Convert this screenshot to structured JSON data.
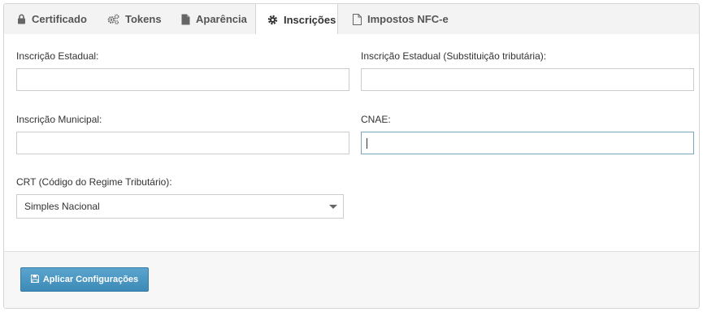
{
  "tabs": [
    {
      "label": "Certificado",
      "icon": "lock-icon"
    },
    {
      "label": "Tokens",
      "icon": "gears-icon"
    },
    {
      "label": "Aparência",
      "icon": "file-icon"
    },
    {
      "label": "Inscrições",
      "icon": "gear-icon",
      "active": true
    },
    {
      "label": "Impostos NFC-e",
      "icon": "file-outline-icon"
    }
  ],
  "form": {
    "inscricao_estadual": {
      "label": "Inscrição Estadual:",
      "value": ""
    },
    "inscricao_estadual_st": {
      "label": "Inscrição Estadual (Substituição tributária):",
      "value": ""
    },
    "inscricao_municipal": {
      "label": "Inscrição Municipal:",
      "value": ""
    },
    "cnae": {
      "label": "CNAE:",
      "value": ""
    },
    "crt": {
      "label": "CRT (Código do Regime Tributário):",
      "selected": "Simples Nacional"
    }
  },
  "footer": {
    "apply_label": "Aplicar Configurações",
    "apply_icon": "save-icon"
  },
  "colors": {
    "accent": "#3d8ab8",
    "focus_border": "#7aa7bf"
  }
}
